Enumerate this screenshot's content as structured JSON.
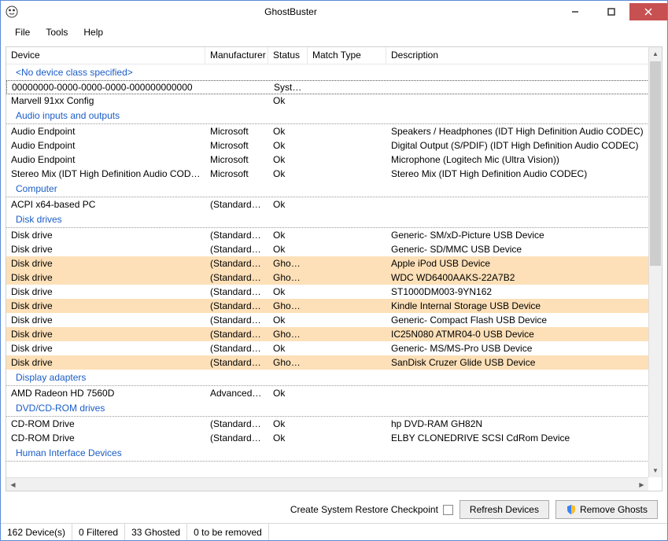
{
  "titlebar": {
    "title": "GhostBuster"
  },
  "menu": {
    "file": "File",
    "tools": "Tools",
    "help": "Help"
  },
  "columns": {
    "device": "Device",
    "manufacturer": "Manufacturer",
    "status": "Status",
    "match": "Match Type",
    "description": "Description"
  },
  "groups": [
    {
      "name": "<No device class specified>",
      "rows": [
        {
          "device": "00000000-0000-0000-0000-000000000000",
          "manuf": "",
          "status": "System",
          "match": "",
          "desc": "",
          "sel": true
        },
        {
          "device": "Marvell 91xx Config",
          "manuf": "",
          "status": "Ok",
          "match": "",
          "desc": ""
        }
      ]
    },
    {
      "name": "Audio inputs and outputs",
      "rows": [
        {
          "device": "Audio Endpoint",
          "manuf": "Microsoft",
          "status": "Ok",
          "match": "",
          "desc": "Speakers / Headphones (IDT High Definition Audio CODEC)"
        },
        {
          "device": "Audio Endpoint",
          "manuf": "Microsoft",
          "status": "Ok",
          "match": "",
          "desc": "Digital Output (S/PDIF) (IDT High Definition Audio CODEC)"
        },
        {
          "device": "Audio Endpoint",
          "manuf": "Microsoft",
          "status": "Ok",
          "match": "",
          "desc": "Microphone (Logitech Mic (Ultra Vision))"
        },
        {
          "device": "Stereo Mix (IDT High Definition Audio CODEC)",
          "manuf": "Microsoft",
          "status": "Ok",
          "match": "",
          "desc": "Stereo Mix (IDT High Definition Audio CODEC)"
        }
      ]
    },
    {
      "name": "Computer",
      "rows": [
        {
          "device": "ACPI x64-based PC",
          "manuf": "(Standard c…",
          "status": "Ok",
          "match": "",
          "desc": ""
        }
      ]
    },
    {
      "name": "Disk drives",
      "rows": [
        {
          "device": "Disk drive",
          "manuf": "(Standard di…",
          "status": "Ok",
          "match": "",
          "desc": "Generic- SM/xD-Picture USB Device"
        },
        {
          "device": "Disk drive",
          "manuf": "(Standard di…",
          "status": "Ok",
          "match": "",
          "desc": "Generic- SD/MMC USB Device"
        },
        {
          "device": "Disk drive",
          "manuf": "(Standard di…",
          "status": "Ghosted",
          "match": "",
          "desc": "Apple iPod USB Device",
          "ghosted": true
        },
        {
          "device": "Disk drive",
          "manuf": "(Standard di…",
          "status": "Ghosted",
          "match": "",
          "desc": "WDC WD6400AAKS-22A7B2",
          "ghosted": true
        },
        {
          "device": "Disk drive",
          "manuf": "(Standard di…",
          "status": "Ok",
          "match": "",
          "desc": "ST1000DM003-9YN162"
        },
        {
          "device": "Disk drive",
          "manuf": "(Standard di…",
          "status": "Ghosted",
          "match": "",
          "desc": "Kindle Internal Storage USB Device",
          "ghosted": true
        },
        {
          "device": "Disk drive",
          "manuf": "(Standard di…",
          "status": "Ok",
          "match": "",
          "desc": "Generic- Compact Flash USB Device"
        },
        {
          "device": "Disk drive",
          "manuf": "(Standard di…",
          "status": "Ghosted",
          "match": "",
          "desc": "IC25N080 ATMR04-0 USB Device",
          "ghosted": true
        },
        {
          "device": "Disk drive",
          "manuf": "(Standard di…",
          "status": "Ok",
          "match": "",
          "desc": "Generic- MS/MS-Pro USB Device"
        },
        {
          "device": "Disk drive",
          "manuf": "(Standard di…",
          "status": "Ghosted",
          "match": "",
          "desc": "SanDisk Cruzer Glide USB Device",
          "ghosted": true
        }
      ]
    },
    {
      "name": "Display adapters",
      "rows": [
        {
          "device": "AMD Radeon HD 7560D",
          "manuf": "Advanced …",
          "status": "Ok",
          "match": "",
          "desc": ""
        }
      ]
    },
    {
      "name": "DVD/CD-ROM drives",
      "rows": [
        {
          "device": "CD-ROM Drive",
          "manuf": "(Standard C…",
          "status": "Ok",
          "match": "",
          "desc": "hp DVD-RAM GH82N"
        },
        {
          "device": "CD-ROM Drive",
          "manuf": "(Standard C…",
          "status": "Ok",
          "match": "",
          "desc": "ELBY CLONEDRIVE SCSI CdRom Device"
        }
      ]
    },
    {
      "name": "Human Interface Devices",
      "rows": []
    }
  ],
  "bottom": {
    "checkbox_label": "Create System Restore Checkpoint",
    "refresh": "Refresh Devices",
    "remove": "Remove Ghosts"
  },
  "status": {
    "devices": "162 Device(s)",
    "filtered": "0 Filtered",
    "ghosted": "33 Ghosted",
    "toremove": "0 to be removed"
  }
}
